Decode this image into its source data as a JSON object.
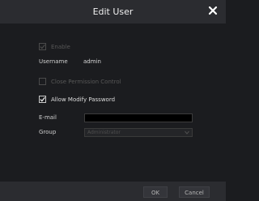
{
  "dialog": {
    "title": "Edit User"
  },
  "form": {
    "enable": {
      "label": "Enable",
      "checked": true,
      "disabled": true
    },
    "username": {
      "label": "Username",
      "value": "admin"
    },
    "close_permission_control": {
      "label": "Close Permission Control",
      "checked": false,
      "disabled": true
    },
    "allow_modify_password": {
      "label": "Allow Modify Password",
      "checked": true,
      "disabled": false
    },
    "email": {
      "label": "E-mail",
      "value": ""
    },
    "group": {
      "label": "Group",
      "selected": "Administrator",
      "disabled": true
    }
  },
  "footer": {
    "ok_label": "OK",
    "cancel_label": "Cancel"
  },
  "icons": {
    "close": "close-icon",
    "checkmark": "checkmark-icon",
    "dropdown": "chevron-down-icon"
  },
  "colors": {
    "background": "#1b1c1f",
    "titlebar": "#2b2c30",
    "text": "#d9d9d9",
    "disabled_text": "#575757"
  }
}
